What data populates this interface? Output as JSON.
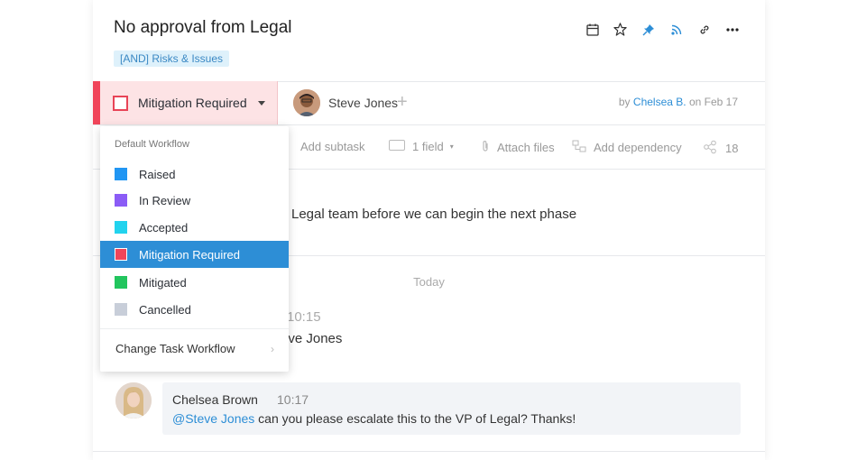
{
  "task": {
    "title": "No approval from Legal",
    "tag": "[AND] Risks & Issues",
    "description": "Legal team before we can begin the next phase"
  },
  "toolbar": {
    "icons": [
      "calendar-icon",
      "star-icon",
      "pin-icon",
      "rss-icon",
      "link-icon",
      "more-icon"
    ]
  },
  "status": {
    "label": "Mitigation Required",
    "color": "#f0455a"
  },
  "assignee": {
    "name": "Steve Jones"
  },
  "byline": {
    "prefix": "by",
    "author": "Chelsea B.",
    "suffix": "on Feb 17"
  },
  "subbar": {
    "add_subtask": "Add subtask",
    "field": "1 field",
    "attach": "Attach files",
    "dependency": "Add dependency",
    "share_count": "18"
  },
  "stream": {
    "date_label": "Today",
    "comment1_time": "10:15",
    "comment1_text": "eve Jones"
  },
  "comment": {
    "author": "Chelsea Brown",
    "time": "10:17",
    "mention": "@Steve Jones",
    "text": " can you please escalate this to the VP of Legal? Thanks!"
  },
  "dropdown": {
    "header": "Default Workflow",
    "items": [
      {
        "label": "Raised",
        "color": "#2196f3"
      },
      {
        "label": "In Review",
        "color": "#8b5cf6"
      },
      {
        "label": "Accepted",
        "color": "#22d3ee"
      },
      {
        "label": "Mitigation Required",
        "color": "#f0455a"
      },
      {
        "label": "Mitigated",
        "color": "#22c55e"
      },
      {
        "label": "Cancelled",
        "color": "#c8ced9"
      }
    ],
    "change_label": "Change Task Workflow"
  }
}
